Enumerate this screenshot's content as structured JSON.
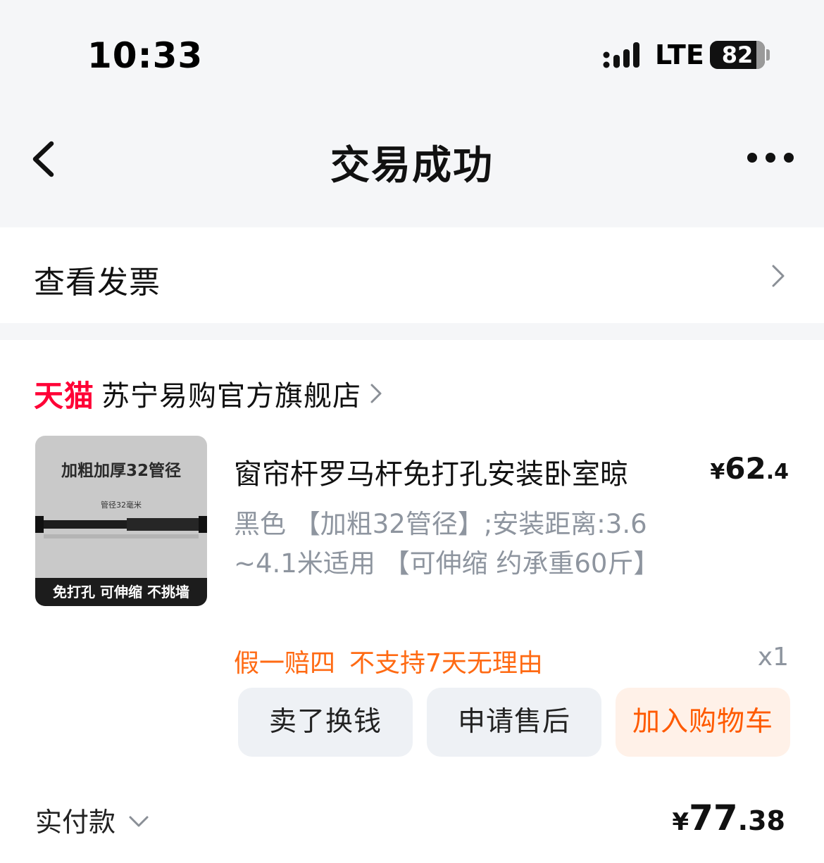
{
  "status_bar": {
    "time": "10:33",
    "network": "LTE",
    "battery": "82"
  },
  "nav": {
    "title": "交易成功"
  },
  "invoice": {
    "label": "查看发票"
  },
  "order": {
    "platform_logo": "天猫",
    "store_name": "苏宁易购官方旗舰店",
    "product": {
      "image_caption": "加粗加厚32管径",
      "image_subcaption": "管径32毫米",
      "image_band": "免打孔 可伸缩 不挑墙",
      "title": "窗帘杆罗马杆免打孔安装卧室晾",
      "price_currency": "¥",
      "price_int": "62",
      "price_dec": ".4",
      "spec": "黑色 【加粗32管径】;安装距离:3.6~4.1米适用 【可伸缩 约承重60斤】",
      "tags": [
        "假一赔四",
        "不支持7天无理由"
      ],
      "quantity": "x1"
    },
    "actions": {
      "sell": "卖了换钱",
      "after_sales": "申请售后",
      "add_to_cart": "加入购物车"
    },
    "paid": {
      "label": "实付款",
      "currency": "¥",
      "int": "77",
      "dec": ".38"
    }
  },
  "colors": {
    "tmall_red": "#ff0036",
    "accent_orange": "#ff5a00",
    "tag_orange": "#ff6a13",
    "muted_gray": "#8e959f"
  }
}
